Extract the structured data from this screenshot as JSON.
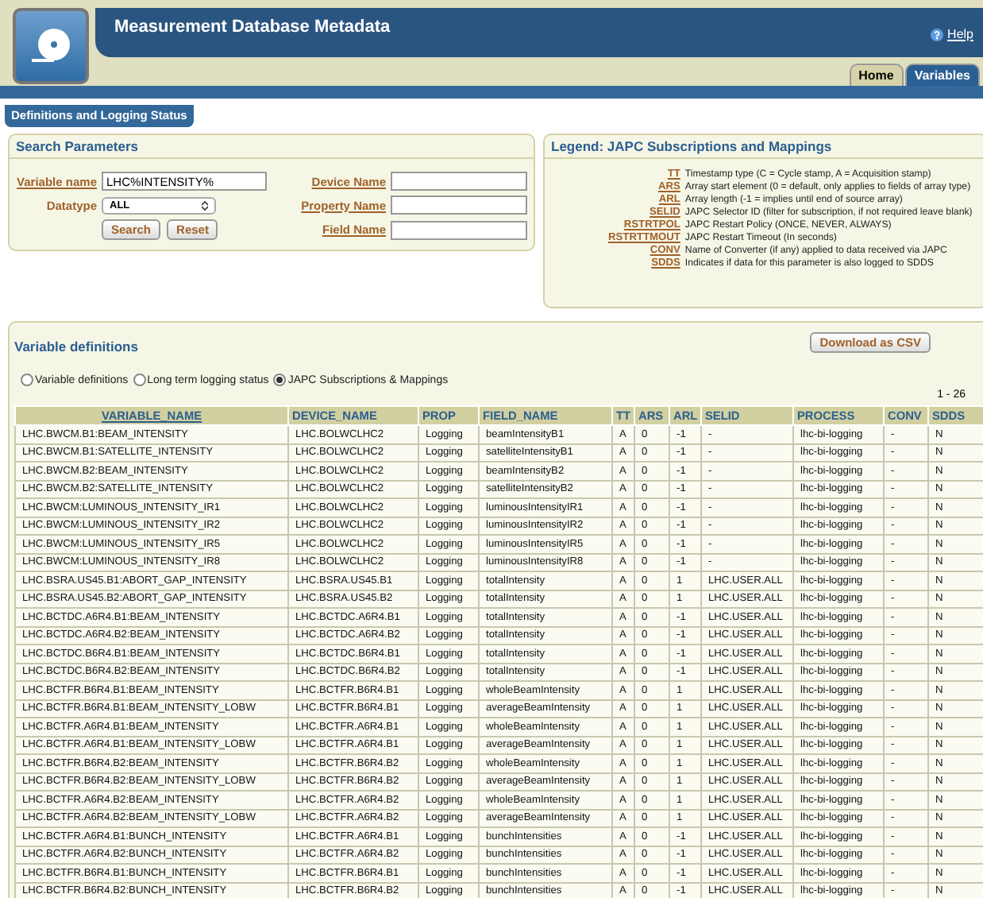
{
  "header": {
    "title": "Measurement Database Metadata",
    "help": "Help"
  },
  "tabs": [
    {
      "label": "Home",
      "selected": false
    },
    {
      "label": "Variables",
      "selected": true
    }
  ],
  "section_tab": "Definitions and Logging Status",
  "search": {
    "title": "Search Parameters",
    "variable_label": "Variable name",
    "variable_value": "LHC%INTENSITY%",
    "datatype_label": "Datatype",
    "datatype_value": "ALL",
    "device_label": "Device Name",
    "property_label": "Property Name",
    "field_label": "Field Name",
    "buttons": [
      "Search",
      "Reset"
    ]
  },
  "legend": {
    "title": "Legend: JAPC Subscriptions and Mappings",
    "items": [
      {
        "key": "TT",
        "text": "Timestamp type (C = Cycle stamp, A = Acquisition stamp)"
      },
      {
        "key": "ARS",
        "text": "Array start element (0 = default, only applies to fields of array type)"
      },
      {
        "key": "ARL",
        "text": "Array length (-1 = implies until end of source array)"
      },
      {
        "key": "SELID",
        "text": "JAPC Selector ID (filter for subscription, if not required leave blank)"
      },
      {
        "key": "RSTRTPOL",
        "text": "JAPC Restart Policy (ONCE, NEVER, ALWAYS)"
      },
      {
        "key": "RSTRTTMOUT",
        "text": "JAPC Restart Timeout (In seconds)"
      },
      {
        "key": "CONV",
        "text": "Name of Converter (if any) applied to data received via JAPC"
      },
      {
        "key": "SDDS",
        "text": "Indicates if data for this parameter is also logged to SDDS"
      }
    ]
  },
  "definitions": {
    "title": "Variable definitions",
    "download": "Download as CSV",
    "views": [
      {
        "label": "Variable definitions",
        "selected": false
      },
      {
        "label": "Long term logging status",
        "selected": false
      },
      {
        "label": "JAPC Subscriptions & Mappings",
        "selected": true
      }
    ],
    "range": "1 - 26",
    "columns": [
      {
        "label": "VARIABLE_NAME",
        "sortable": true
      },
      {
        "label": "DEVICE_NAME",
        "sortable": false
      },
      {
        "label": "PROP",
        "sortable": false
      },
      {
        "label": "FIELD_NAME",
        "sortable": false
      },
      {
        "label": "TT",
        "sortable": false
      },
      {
        "label": "ARS",
        "sortable": false
      },
      {
        "label": "ARL",
        "sortable": false
      },
      {
        "label": "SELID",
        "sortable": false
      },
      {
        "label": "PROCESS",
        "sortable": false
      },
      {
        "label": "CONV",
        "sortable": false
      },
      {
        "label": "SDDS",
        "sortable": false
      }
    ],
    "rows": [
      [
        "LHC.BWCM.B1:BEAM_INTENSITY",
        "LHC.BOLWCLHC2",
        "Logging",
        "beamIntensityB1",
        "A",
        "0",
        "-1",
        "-",
        "lhc-bi-logging",
        "-",
        "N"
      ],
      [
        "LHC.BWCM.B1:SATELLITE_INTENSITY",
        "LHC.BOLWCLHC2",
        "Logging",
        "satelliteIntensityB1",
        "A",
        "0",
        "-1",
        "-",
        "lhc-bi-logging",
        "-",
        "N"
      ],
      [
        "LHC.BWCM.B2:BEAM_INTENSITY",
        "LHC.BOLWCLHC2",
        "Logging",
        "beamIntensityB2",
        "A",
        "0",
        "-1",
        "-",
        "lhc-bi-logging",
        "-",
        "N"
      ],
      [
        "LHC.BWCM.B2:SATELLITE_INTENSITY",
        "LHC.BOLWCLHC2",
        "Logging",
        "satelliteIntensityB2",
        "A",
        "0",
        "-1",
        "-",
        "lhc-bi-logging",
        "-",
        "N"
      ],
      [
        "LHC.BWCM:LUMINOUS_INTENSITY_IR1",
        "LHC.BOLWCLHC2",
        "Logging",
        "luminousIntensityIR1",
        "A",
        "0",
        "-1",
        "-",
        "lhc-bi-logging",
        "-",
        "N"
      ],
      [
        "LHC.BWCM:LUMINOUS_INTENSITY_IR2",
        "LHC.BOLWCLHC2",
        "Logging",
        "luminousIntensityIR2",
        "A",
        "0",
        "-1",
        "-",
        "lhc-bi-logging",
        "-",
        "N"
      ],
      [
        "LHC.BWCM:LUMINOUS_INTENSITY_IR5",
        "LHC.BOLWCLHC2",
        "Logging",
        "luminousIntensityIR5",
        "A",
        "0",
        "-1",
        "-",
        "lhc-bi-logging",
        "-",
        "N"
      ],
      [
        "LHC.BWCM:LUMINOUS_INTENSITY_IR8",
        "LHC.BOLWCLHC2",
        "Logging",
        "luminousIntensityIR8",
        "A",
        "0",
        "-1",
        "-",
        "lhc-bi-logging",
        "-",
        "N"
      ],
      [
        "LHC.BSRA.US45.B1:ABORT_GAP_INTENSITY",
        "LHC.BSRA.US45.B1",
        "Logging",
        "totalIntensity",
        "A",
        "0",
        "1",
        "LHC.USER.ALL",
        "lhc-bi-logging",
        "-",
        "N"
      ],
      [
        "LHC.BSRA.US45.B2:ABORT_GAP_INTENSITY",
        "LHC.BSRA.US45.B2",
        "Logging",
        "totalIntensity",
        "A",
        "0",
        "1",
        "LHC.USER.ALL",
        "lhc-bi-logging",
        "-",
        "N"
      ],
      [
        "LHC.BCTDC.A6R4.B1:BEAM_INTENSITY",
        "LHC.BCTDC.A6R4.B1",
        "Logging",
        "totalIntensity",
        "A",
        "0",
        "-1",
        "LHC.USER.ALL",
        "lhc-bi-logging",
        "-",
        "N"
      ],
      [
        "LHC.BCTDC.A6R4.B2:BEAM_INTENSITY",
        "LHC.BCTDC.A6R4.B2",
        "Logging",
        "totalIntensity",
        "A",
        "0",
        "-1",
        "LHC.USER.ALL",
        "lhc-bi-logging",
        "-",
        "N"
      ],
      [
        "LHC.BCTDC.B6R4.B1:BEAM_INTENSITY",
        "LHC.BCTDC.B6R4.B1",
        "Logging",
        "totalIntensity",
        "A",
        "0",
        "-1",
        "LHC.USER.ALL",
        "lhc-bi-logging",
        "-",
        "N"
      ],
      [
        "LHC.BCTDC.B6R4.B2:BEAM_INTENSITY",
        "LHC.BCTDC.B6R4.B2",
        "Logging",
        "totalIntensity",
        "A",
        "0",
        "-1",
        "LHC.USER.ALL",
        "lhc-bi-logging",
        "-",
        "N"
      ],
      [
        "LHC.BCTFR.B6R4.B1:BEAM_INTENSITY",
        "LHC.BCTFR.B6R4.B1",
        "Logging",
        "wholeBeamIntensity",
        "A",
        "0",
        "1",
        "LHC.USER.ALL",
        "lhc-bi-logging",
        "-",
        "N"
      ],
      [
        "LHC.BCTFR.B6R4.B1:BEAM_INTENSITY_LOBW",
        "LHC.BCTFR.B6R4.B1",
        "Logging",
        "averageBeamIntensity",
        "A",
        "0",
        "1",
        "LHC.USER.ALL",
        "lhc-bi-logging",
        "-",
        "N"
      ],
      [
        "LHC.BCTFR.A6R4.B1:BEAM_INTENSITY",
        "LHC.BCTFR.A6R4.B1",
        "Logging",
        "wholeBeamIntensity",
        "A",
        "0",
        "1",
        "LHC.USER.ALL",
        "lhc-bi-logging",
        "-",
        "N"
      ],
      [
        "LHC.BCTFR.A6R4.B1:BEAM_INTENSITY_LOBW",
        "LHC.BCTFR.A6R4.B1",
        "Logging",
        "averageBeamIntensity",
        "A",
        "0",
        "1",
        "LHC.USER.ALL",
        "lhc-bi-logging",
        "-",
        "N"
      ],
      [
        "LHC.BCTFR.B6R4.B2:BEAM_INTENSITY",
        "LHC.BCTFR.B6R4.B2",
        "Logging",
        "wholeBeamIntensity",
        "A",
        "0",
        "1",
        "LHC.USER.ALL",
        "lhc-bi-logging",
        "-",
        "N"
      ],
      [
        "LHC.BCTFR.B6R4.B2:BEAM_INTENSITY_LOBW",
        "LHC.BCTFR.B6R4.B2",
        "Logging",
        "averageBeamIntensity",
        "A",
        "0",
        "1",
        "LHC.USER.ALL",
        "lhc-bi-logging",
        "-",
        "N"
      ],
      [
        "LHC.BCTFR.A6R4.B2:BEAM_INTENSITY",
        "LHC.BCTFR.A6R4.B2",
        "Logging",
        "wholeBeamIntensity",
        "A",
        "0",
        "1",
        "LHC.USER.ALL",
        "lhc-bi-logging",
        "-",
        "N"
      ],
      [
        "LHC.BCTFR.A6R4.B2:BEAM_INTENSITY_LOBW",
        "LHC.BCTFR.A6R4.B2",
        "Logging",
        "averageBeamIntensity",
        "A",
        "0",
        "1",
        "LHC.USER.ALL",
        "lhc-bi-logging",
        "-",
        "N"
      ],
      [
        "LHC.BCTFR.A6R4.B1:BUNCH_INTENSITY",
        "LHC.BCTFR.A6R4.B1",
        "Logging",
        "bunchIntensities",
        "A",
        "0",
        "-1",
        "LHC.USER.ALL",
        "lhc-bi-logging",
        "-",
        "N"
      ],
      [
        "LHC.BCTFR.A6R4.B2:BUNCH_INTENSITY",
        "LHC.BCTFR.A6R4.B2",
        "Logging",
        "bunchIntensities",
        "A",
        "0",
        "-1",
        "LHC.USER.ALL",
        "lhc-bi-logging",
        "-",
        "N"
      ],
      [
        "LHC.BCTFR.B6R4.B1:BUNCH_INTENSITY",
        "LHC.BCTFR.B6R4.B1",
        "Logging",
        "bunchIntensities",
        "A",
        "0",
        "-1",
        "LHC.USER.ALL",
        "lhc-bi-logging",
        "-",
        "N"
      ],
      [
        "LHC.BCTFR.B6R4.B2:BUNCH_INTENSITY",
        "LHC.BCTFR.B6R4.B2",
        "Logging",
        "bunchIntensities",
        "A",
        "0",
        "-1",
        "LHC.USER.ALL",
        "lhc-bi-logging",
        "-",
        "N"
      ]
    ]
  }
}
